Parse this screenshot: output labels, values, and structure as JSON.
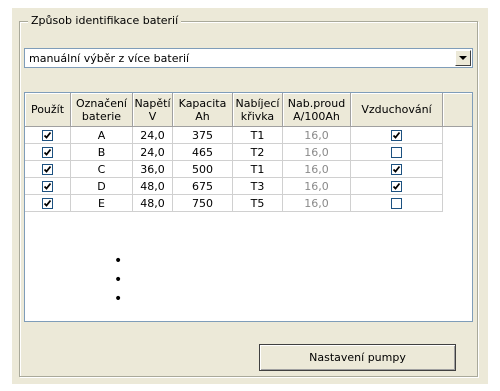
{
  "group": {
    "title": "Způsob identifikace baterií"
  },
  "mode_select": {
    "value": "manuální výběr z více baterií",
    "arrow_icon": "chevron-down-icon"
  },
  "table": {
    "headers": [
      {
        "line1": "Použít",
        "line2": ""
      },
      {
        "line1": "Označení",
        "line2": "baterie"
      },
      {
        "line1": "Napětí",
        "line2": "V"
      },
      {
        "line1": "Kapacita",
        "line2": "Ah"
      },
      {
        "line1": "Nabíjecí",
        "line2": "křivka"
      },
      {
        "line1": "Nab.proud",
        "line2": "A/100Ah"
      },
      {
        "line1": "Vzduchování",
        "line2": ""
      }
    ],
    "rows": [
      {
        "use": true,
        "label": "A",
        "voltage": "24,0",
        "capacity": "375",
        "curve": "T1",
        "current": "16,0",
        "aeration": true
      },
      {
        "use": true,
        "label": "B",
        "voltage": "24,0",
        "capacity": "465",
        "curve": "T2",
        "current": "16,0",
        "aeration": false
      },
      {
        "use": true,
        "label": "C",
        "voltage": "36,0",
        "capacity": "500",
        "curve": "T1",
        "current": "16,0",
        "aeration": true
      },
      {
        "use": true,
        "label": "D",
        "voltage": "48,0",
        "capacity": "675",
        "curve": "T3",
        "current": "16,0",
        "aeration": true
      },
      {
        "use": true,
        "label": "E",
        "voltage": "48,0",
        "capacity": "750",
        "curve": "T5",
        "current": "16,0",
        "aeration": false
      }
    ],
    "ellipsis": [
      "•",
      "•",
      "•"
    ]
  },
  "buttons": {
    "pump_settings": "Nastavení pumpy"
  },
  "colors": {
    "window_bg": "#ece9d8",
    "field_border": "#7f9db9",
    "checkbox_border": "#1c5180",
    "disabled_text": "#8a8a8a"
  }
}
